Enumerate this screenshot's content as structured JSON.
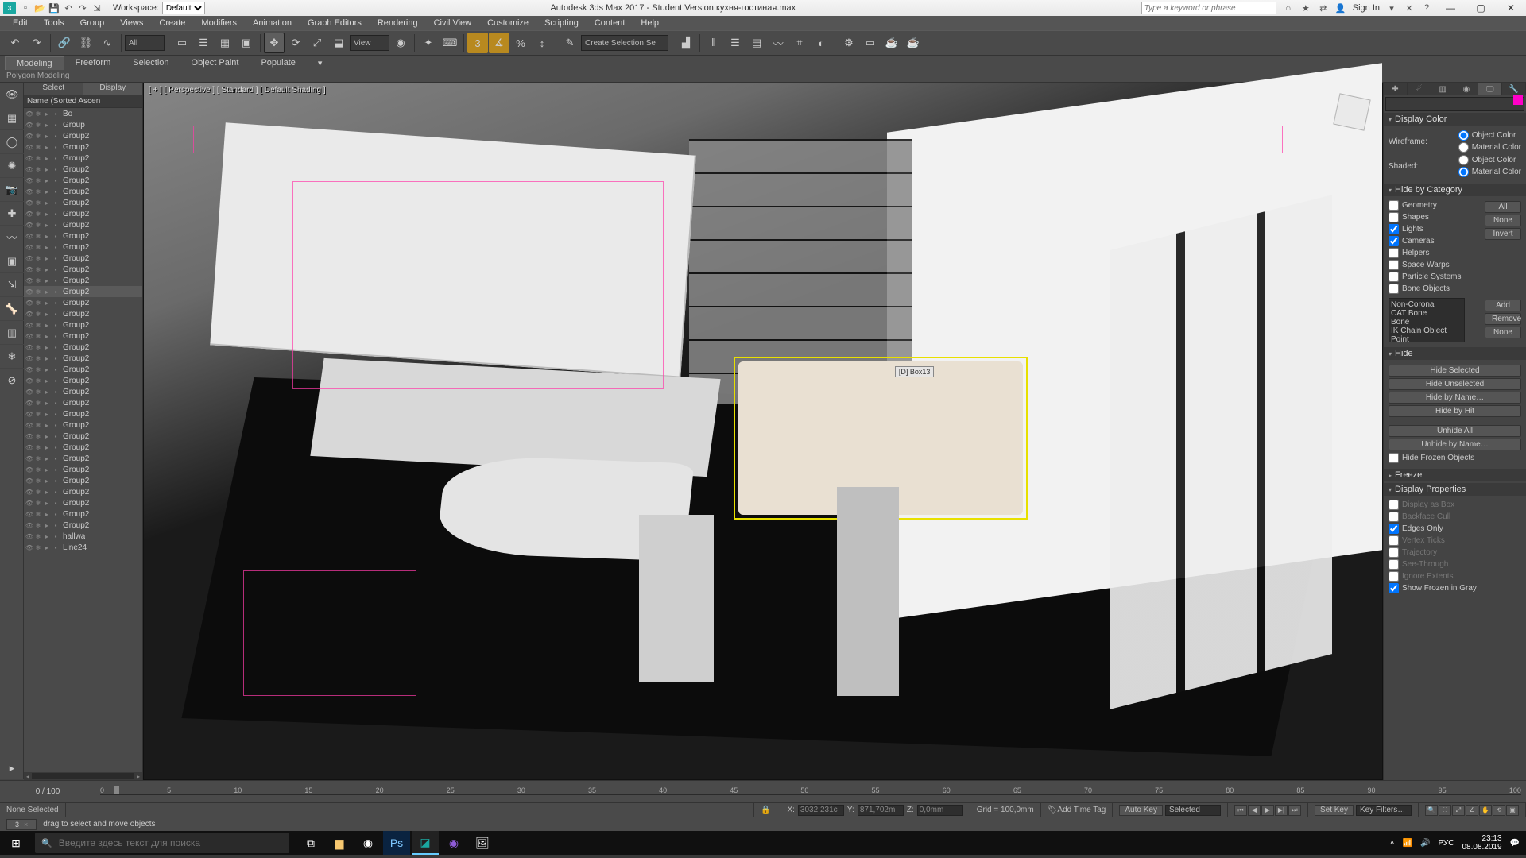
{
  "titlebar": {
    "app_abbr": "3",
    "workspace_label": "Workspace:",
    "workspace_value": "Default",
    "title": "Autodesk 3ds Max 2017 - Student Version   кухня-гостиная.max",
    "search_placeholder": "Type a keyword or phrase",
    "signin": "Sign In"
  },
  "menubar": [
    "Edit",
    "Tools",
    "Group",
    "Views",
    "Create",
    "Modifiers",
    "Animation",
    "Graph Editors",
    "Rendering",
    "Civil View",
    "Customize",
    "Scripting",
    "Content",
    "Help"
  ],
  "toolstrip": {
    "all_combo": "All",
    "view_combo": "View",
    "create_sel": "Create Selection Se"
  },
  "ribbon": {
    "tabs": [
      "Modeling",
      "Freeform",
      "Selection",
      "Object Paint",
      "Populate"
    ],
    "active": 0,
    "sub": "Polygon Modeling"
  },
  "scene": {
    "tab_select": "Select",
    "tab_display": "Display",
    "header": "Name (Sorted Ascen",
    "rows": [
      {
        "name": "Bo",
        "sel": false
      },
      {
        "name": "Group",
        "sel": false
      },
      {
        "name": "Group2",
        "sel": false
      },
      {
        "name": "Group2",
        "sel": false
      },
      {
        "name": "Group2",
        "sel": false
      },
      {
        "name": "Group2",
        "sel": false
      },
      {
        "name": "Group2",
        "sel": false
      },
      {
        "name": "Group2",
        "sel": false
      },
      {
        "name": "Group2",
        "sel": false
      },
      {
        "name": "Group2",
        "sel": false
      },
      {
        "name": "Group2",
        "sel": false
      },
      {
        "name": "Group2",
        "sel": false
      },
      {
        "name": "Group2",
        "sel": false
      },
      {
        "name": "Group2",
        "sel": false
      },
      {
        "name": "Group2",
        "sel": false
      },
      {
        "name": "Group2",
        "sel": false
      },
      {
        "name": "Group2",
        "sel": true
      },
      {
        "name": "Group2",
        "sel": false
      },
      {
        "name": "Group2",
        "sel": false
      },
      {
        "name": "Group2",
        "sel": false
      },
      {
        "name": "Group2",
        "sel": false
      },
      {
        "name": "Group2",
        "sel": false
      },
      {
        "name": "Group2",
        "sel": false
      },
      {
        "name": "Group2",
        "sel": false
      },
      {
        "name": "Group2",
        "sel": false
      },
      {
        "name": "Group2",
        "sel": false
      },
      {
        "name": "Group2",
        "sel": false
      },
      {
        "name": "Group2",
        "sel": false
      },
      {
        "name": "Group2",
        "sel": false
      },
      {
        "name": "Group2",
        "sel": false
      },
      {
        "name": "Group2",
        "sel": false
      },
      {
        "name": "Group2",
        "sel": false
      },
      {
        "name": "Group2",
        "sel": false
      },
      {
        "name": "Group2",
        "sel": false
      },
      {
        "name": "Group2",
        "sel": false
      },
      {
        "name": "Group2",
        "sel": false
      },
      {
        "name": "Group2",
        "sel": false
      },
      {
        "name": "Group2",
        "sel": false
      },
      {
        "name": "hallwa",
        "sel": false
      },
      {
        "name": "Line24",
        "sel": false
      }
    ]
  },
  "viewport": {
    "label": "[ + ] [ Perspective ] [ Standard ] [ Default Shading ]",
    "sel_label": "[D] Box13"
  },
  "rightpanel": {
    "display_color": {
      "title": "Display Color",
      "wireframe": "Wireframe:",
      "shaded": "Shaded:",
      "object_color": "Object Color",
      "material_color": "Material Color"
    },
    "hide_cat": {
      "title": "Hide by Category",
      "items": [
        "Geometry",
        "Shapes",
        "Lights",
        "Cameras",
        "Helpers",
        "Space Warps",
        "Particle Systems",
        "Bone Objects"
      ],
      "checked": [
        2,
        3
      ],
      "btn_all": "All",
      "btn_none": "None",
      "btn_invert": "Invert",
      "list": [
        "Non-Corona",
        "CAT Bone",
        "Bone",
        "IK Chain Object",
        "Point"
      ],
      "btn_add": "Add",
      "btn_remove": "Remove",
      "btn_none2": "None"
    },
    "hide": {
      "title": "Hide",
      "btns": [
        "Hide Selected",
        "Hide Unselected",
        "Hide by Name…",
        "Hide by Hit",
        "Unhide All",
        "Unhide by Name…"
      ],
      "chk": "Hide Frozen Objects"
    },
    "freeze": {
      "title": "Freeze"
    },
    "display_props": {
      "title": "Display Properties",
      "items": [
        "Display as Box",
        "Backface Cull",
        "Edges Only",
        "Vertex Ticks",
        "Trajectory",
        "See-Through",
        "Ignore Extents",
        "Show Frozen in Gray"
      ],
      "checked": [
        2,
        7
      ]
    }
  },
  "timeline": {
    "frame": "0 / 100",
    "ticks": [
      "0",
      "5",
      "10",
      "15",
      "20",
      "25",
      "30",
      "35",
      "40",
      "45",
      "50",
      "55",
      "60",
      "65",
      "70",
      "75",
      "80",
      "85",
      "90",
      "95",
      "100"
    ]
  },
  "status": {
    "none_selected": "None Selected",
    "x_label": "X:",
    "x_val": "3032,231c",
    "y_label": "Y:",
    "y_val": "871,702m",
    "z_label": "Z:",
    "z_val": "0,0mm",
    "grid": "Grid = 100,0mm",
    "add_time_tag": "Add Time Tag",
    "autokey": "Auto Key",
    "setkey": "Set Key",
    "selected": "Selected",
    "keyfilters": "Key Filters…"
  },
  "prompt": {
    "hint": "drag to select and move objects",
    "scene_tab": "3"
  },
  "taskbar": {
    "search_placeholder": "Введите здесь текст для поиска",
    "lang": "РУС",
    "time": "23:13",
    "date": "08.08.2019"
  }
}
